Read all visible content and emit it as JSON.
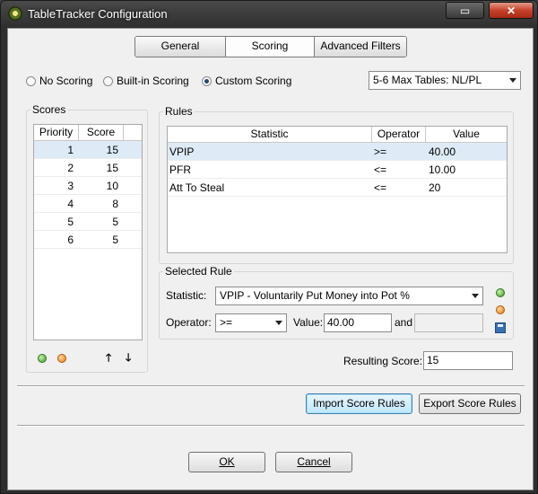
{
  "window": {
    "title": "TableTracker Configuration",
    "restore_glyph": "▭",
    "close_glyph": "✕"
  },
  "tabs": [
    "General",
    "Scoring",
    "Advanced Filters"
  ],
  "scoring_mode": {
    "options": [
      "No Scoring",
      "Built-in Scoring",
      "Custom Scoring"
    ],
    "selected": "Custom Scoring"
  },
  "table_type": {
    "value": "5-6 Max Tables: NL/PL"
  },
  "scores": {
    "title": "Scores",
    "columns": [
      "Priority",
      "Score"
    ],
    "rows": [
      {
        "priority": "1",
        "score": "15"
      },
      {
        "priority": "2",
        "score": "15"
      },
      {
        "priority": "3",
        "score": "10"
      },
      {
        "priority": "4",
        "score": "8"
      },
      {
        "priority": "5",
        "score": "5"
      },
      {
        "priority": "6",
        "score": "5"
      }
    ],
    "up_glyph": "🡑",
    "down_glyph": "🡓"
  },
  "rules": {
    "title": "Rules",
    "columns": [
      "Statistic",
      "Operator",
      "Value"
    ],
    "rows": [
      {
        "statistic": "VPIP",
        "operator": ">=",
        "value": "40.00"
      },
      {
        "statistic": "PFR",
        "operator": "<=",
        "value": "10.00"
      },
      {
        "statistic": "Att To Steal",
        "operator": "<=",
        "value": "20"
      }
    ]
  },
  "selected_rule": {
    "title": "Selected Rule",
    "statistic_label": "Statistic:",
    "statistic_value": "VPIP - Voluntarily Put Money into Pot %",
    "operator_label": "Operator:",
    "operator_value": ">=",
    "value_label": "Value:",
    "value": "40.00",
    "and_label": "and",
    "and_value": ""
  },
  "resulting_score": {
    "label": "Resulting Score:",
    "value": "15"
  },
  "buttons": {
    "import": "Import Score Rules",
    "export": "Export Score Rules",
    "ok": "OK",
    "cancel": "Cancel"
  },
  "icons": {
    "add": "add-icon",
    "remove": "remove-icon",
    "save": "save-icon"
  }
}
